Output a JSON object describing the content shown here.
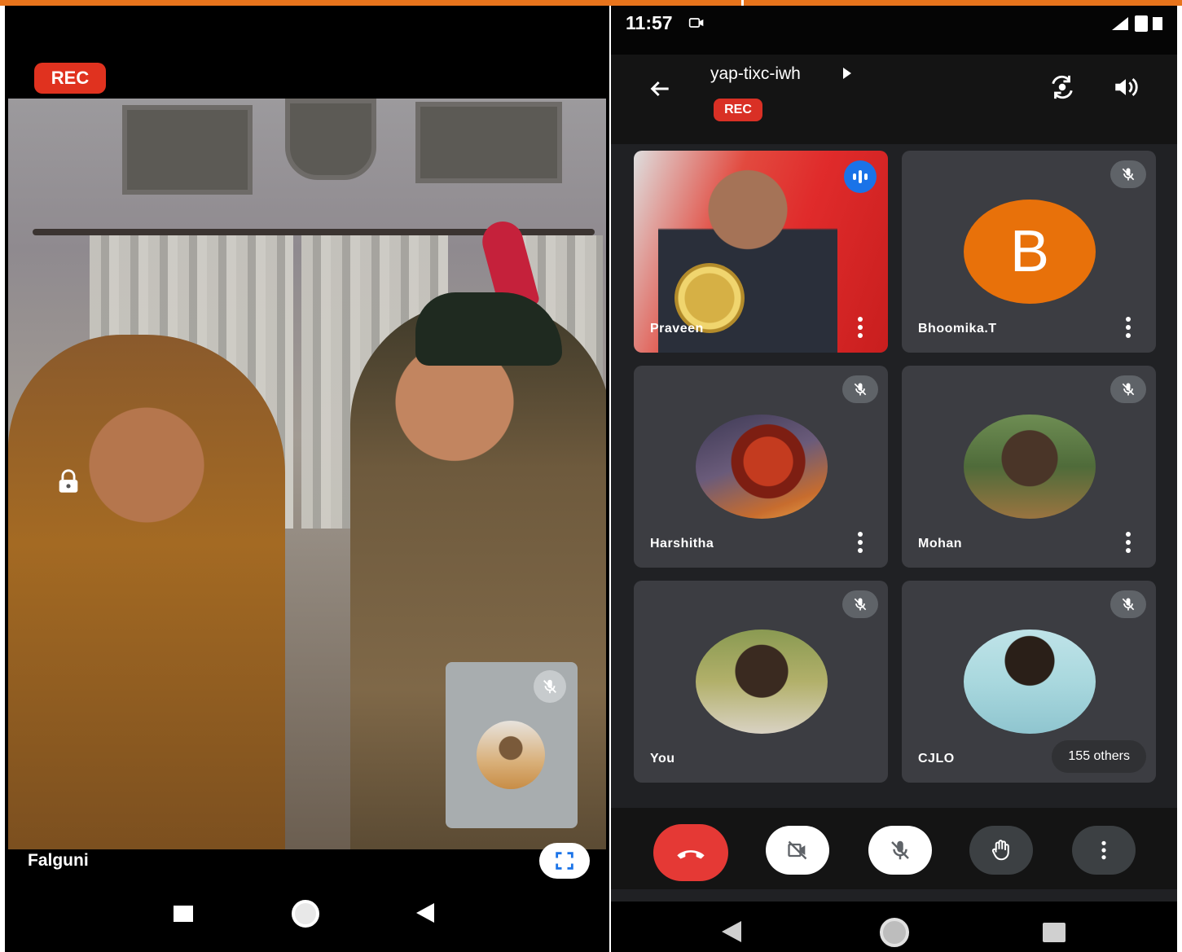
{
  "left_phone": {
    "rec_badge": "REC",
    "participant_name": "Falguni",
    "icons": [
      "lock-icon",
      "mic-off-icon",
      "fullscreen-icon"
    ],
    "nav": [
      "recent-apps",
      "home",
      "back"
    ]
  },
  "right_phone": {
    "status_bar": {
      "time": "11:57"
    },
    "header": {
      "meeting_code": "yap-tixc-iwh",
      "rec_badge": "REC"
    },
    "tiles": [
      {
        "name": "Praveen",
        "type": "video",
        "speaking": true
      },
      {
        "name": "Bhoomika.T",
        "type": "letter",
        "letter": "B",
        "muted": true
      },
      {
        "name": "Harshitha",
        "type": "photo",
        "muted": true
      },
      {
        "name": "Mohan",
        "type": "photo",
        "muted": true
      },
      {
        "name": "You",
        "type": "photo",
        "muted": true
      },
      {
        "name": "CJLO",
        "type": "photo",
        "muted": true,
        "others_label": "155 others"
      }
    ],
    "controls": [
      "hang-up",
      "camera-off",
      "mic-off",
      "raise-hand",
      "more-options"
    ]
  },
  "colors": {
    "accent_bar": "#e8741c",
    "rec": "#e0321f",
    "hangup": "#e53935",
    "avatar_orange": "#e8710a",
    "speaking_blue": "#1a73e8"
  }
}
